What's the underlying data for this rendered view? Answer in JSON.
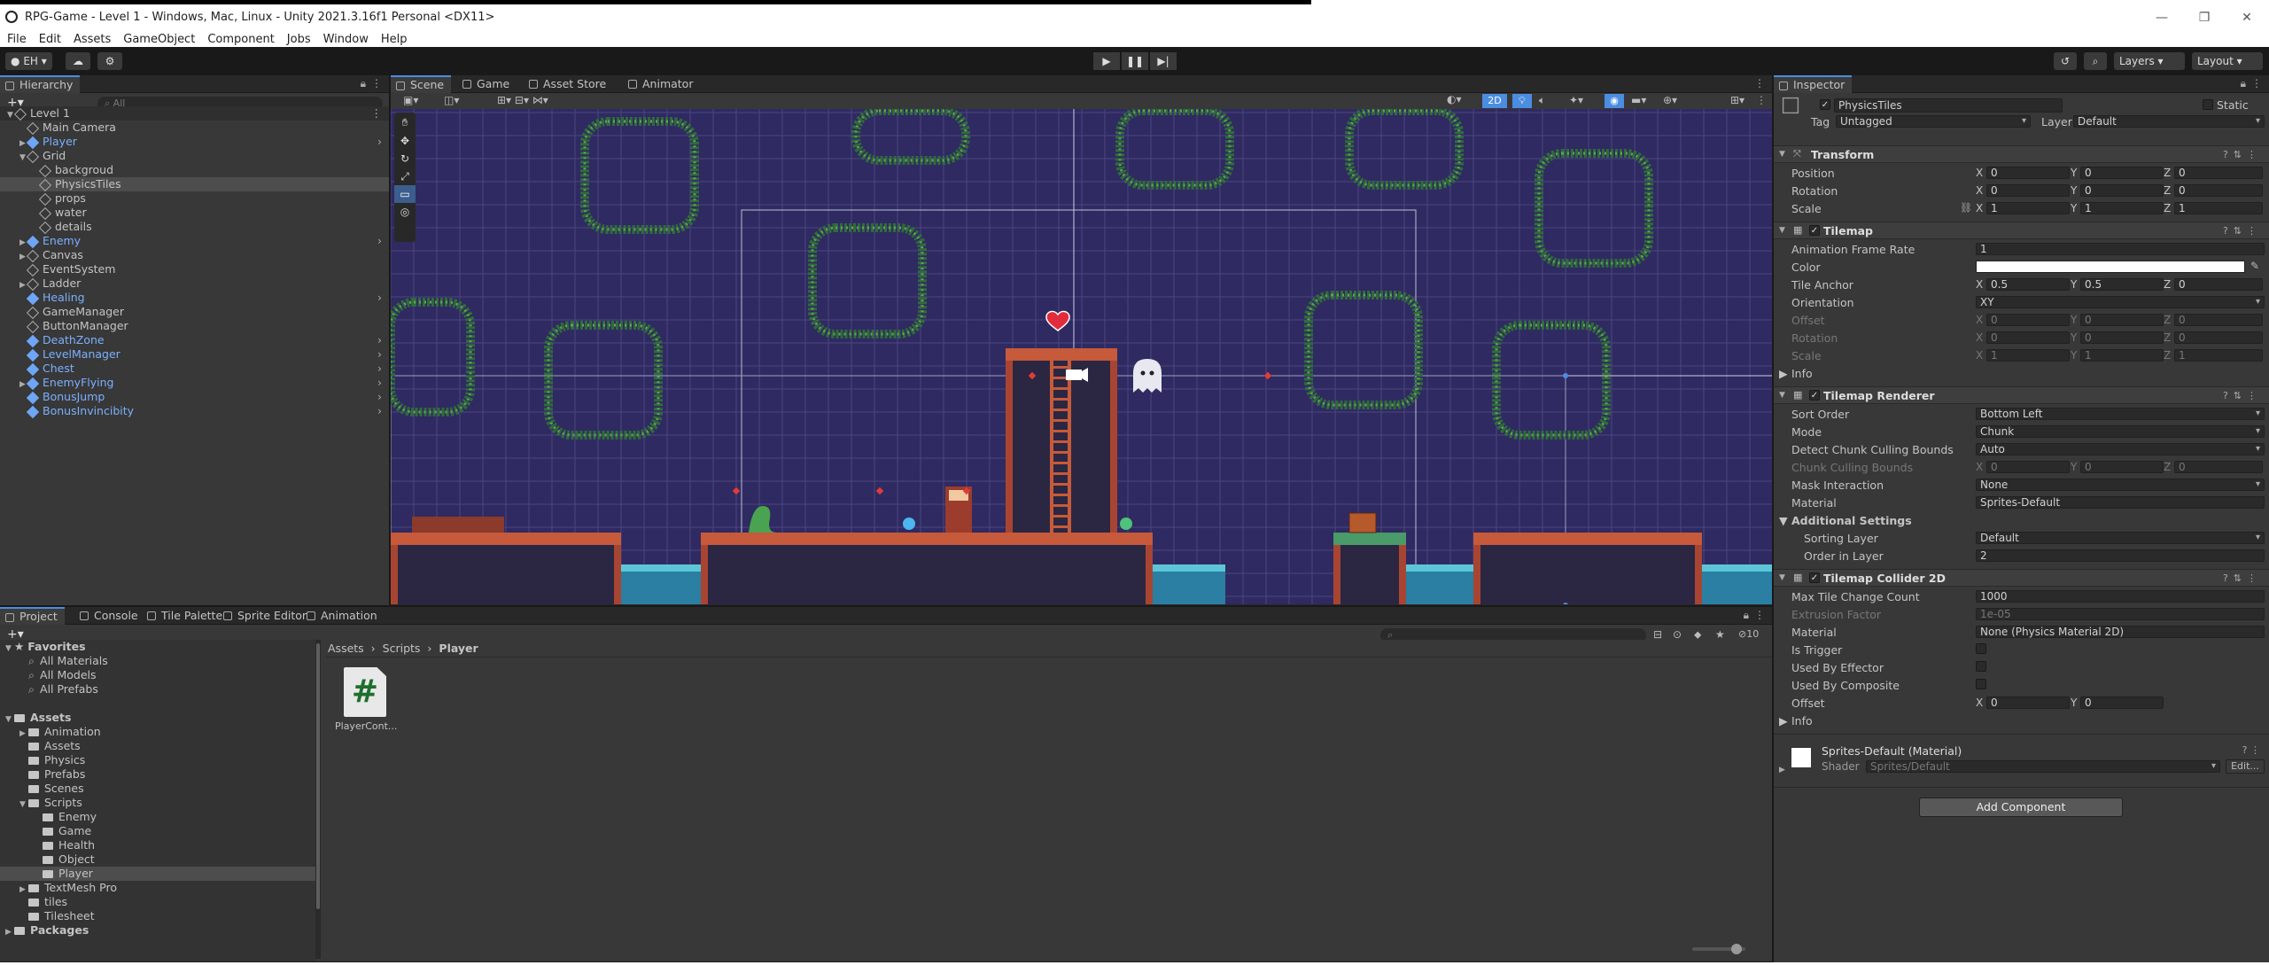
{
  "window": {
    "title": "RPG-Game - Level 1 - Windows, Mac, Linux - Unity 2021.3.16f1 Personal <DX11>",
    "minimize": "—",
    "maximize": "❐",
    "close": "✕"
  },
  "menu": [
    "File",
    "Edit",
    "Assets",
    "GameObject",
    "Component",
    "Jobs",
    "Window",
    "Help"
  ],
  "toolbar": {
    "account": "EH",
    "layers": "Layers",
    "layout": "Layout"
  },
  "hierarchy": {
    "tab": "Hierarchy",
    "search_placeholder": "All",
    "items": [
      {
        "label": "Level 1",
        "depth": 0,
        "expanded": true,
        "type": "scene"
      },
      {
        "label": "Main Camera",
        "depth": 1,
        "type": "object"
      },
      {
        "label": "Player",
        "depth": 1,
        "type": "prefab",
        "collapsed": true
      },
      {
        "label": "Grid",
        "depth": 1,
        "type": "object",
        "expanded": true
      },
      {
        "label": "backgroud",
        "depth": 2,
        "type": "object"
      },
      {
        "label": "PhysicsTiles",
        "depth": 2,
        "type": "object",
        "selected": true
      },
      {
        "label": "props",
        "depth": 2,
        "type": "object"
      },
      {
        "label": "water",
        "depth": 2,
        "type": "object"
      },
      {
        "label": "details",
        "depth": 2,
        "type": "object"
      },
      {
        "label": "Enemy",
        "depth": 1,
        "type": "prefab",
        "collapsed": true
      },
      {
        "label": "Canvas",
        "depth": 1,
        "type": "object",
        "collapsed": true
      },
      {
        "label": "EventSystem",
        "depth": 1,
        "type": "object"
      },
      {
        "label": "Ladder",
        "depth": 1,
        "type": "object",
        "collapsed": true
      },
      {
        "label": "Healing",
        "depth": 1,
        "type": "prefab"
      },
      {
        "label": "GameManager",
        "depth": 1,
        "type": "object"
      },
      {
        "label": "ButtonManager",
        "depth": 1,
        "type": "object"
      },
      {
        "label": "DeathZone",
        "depth": 1,
        "type": "prefab"
      },
      {
        "label": "LevelManager",
        "depth": 1,
        "type": "prefab"
      },
      {
        "label": "Chest",
        "depth": 1,
        "type": "prefab"
      },
      {
        "label": "EnemyFlying",
        "depth": 1,
        "type": "prefab",
        "collapsed": true
      },
      {
        "label": "BonusJump",
        "depth": 1,
        "type": "prefab"
      },
      {
        "label": "BonusInvincibity",
        "depth": 1,
        "type": "prefab"
      }
    ]
  },
  "scene_tabs": [
    {
      "label": "Scene",
      "active": true
    },
    {
      "label": "Game"
    },
    {
      "label": "Asset Store"
    },
    {
      "label": "Animator"
    }
  ],
  "scene_toolbar": {
    "mode_2d": "2D"
  },
  "inspector": {
    "tab": "Inspector",
    "object_name": "PhysicsTiles",
    "static_label": "Static",
    "tag_label": "Tag",
    "tag_value": "Untagged",
    "layer_label": "Layer",
    "layer_value": "Default",
    "transform": {
      "title": "Transform",
      "position_label": "Position",
      "position": [
        "0",
        "0",
        "0"
      ],
      "rotation_label": "Rotation",
      "rotation": [
        "0",
        "0",
        "0"
      ],
      "scale_label": "Scale",
      "scale": [
        "1",
        "1",
        "1"
      ]
    },
    "tilemap": {
      "title": "Tilemap",
      "anim_frame_rate_label": "Animation Frame Rate",
      "anim_frame_rate": "1",
      "color_label": "Color",
      "tile_anchor_label": "Tile Anchor",
      "tile_anchor": [
        "0.5",
        "0.5",
        "0"
      ],
      "orientation_label": "Orientation",
      "orientation": "XY",
      "offset_label": "Offset",
      "offset": [
        "0",
        "0",
        "0"
      ],
      "rotation_label": "Rotation",
      "rotation": [
        "0",
        "0",
        "0"
      ],
      "scale_label": "Scale",
      "scale": [
        "1",
        "1",
        "1"
      ],
      "info_label": "Info"
    },
    "tilemap_renderer": {
      "title": "Tilemap Renderer",
      "sort_order_label": "Sort Order",
      "sort_order": "Bottom Left",
      "mode_label": "Mode",
      "mode": "Chunk",
      "detect_label": "Detect Chunk Culling Bounds",
      "detect": "Auto",
      "chunk_bounds_label": "Chunk Culling Bounds",
      "chunk_bounds": [
        "0",
        "0",
        "0"
      ],
      "mask_label": "Mask Interaction",
      "mask": "None",
      "material_label": "Material",
      "material": "Sprites-Default",
      "additional_label": "Additional Settings",
      "sorting_layer_label": "Sorting Layer",
      "sorting_layer": "Default",
      "order_label": "Order in Layer",
      "order": "2"
    },
    "tilemap_collider": {
      "title": "Tilemap Collider 2D",
      "max_tile_label": "Max Tile Change Count",
      "max_tile": "1000",
      "extrusion_label": "Extrusion Factor",
      "extrusion": "1e-05",
      "material_label": "Material",
      "material": "None (Physics Material 2D)",
      "trigger_label": "Is Trigger",
      "effector_label": "Used By Effector",
      "composite_label": "Used By Composite",
      "offset_label": "Offset",
      "offset": [
        "0",
        "0"
      ],
      "info_label": "Info"
    },
    "material_block": {
      "name": "Sprites-Default (Material)",
      "shader_label": "Shader",
      "shader": "Sprites/Default",
      "edit": "Edit..."
    },
    "add_component": "Add Component",
    "axis": [
      "X",
      "Y",
      "Z"
    ]
  },
  "bottom_tabs": [
    {
      "label": "Project",
      "active": true
    },
    {
      "label": "Console"
    },
    {
      "label": "Tile Palette"
    },
    {
      "label": "Sprite Editor"
    },
    {
      "label": "Animation"
    }
  ],
  "project": {
    "favorites_label": "Favorites",
    "favorites": [
      "All Materials",
      "All Models",
      "All Prefabs"
    ],
    "assets_label": "Assets",
    "folders": [
      {
        "label": "Animation",
        "depth": 1,
        "collapsed": true
      },
      {
        "label": "Assets",
        "depth": 1
      },
      {
        "label": "Physics",
        "depth": 1
      },
      {
        "label": "Prefabs",
        "depth": 1
      },
      {
        "label": "Scenes",
        "depth": 1
      },
      {
        "label": "Scripts",
        "depth": 1,
        "expanded": true
      },
      {
        "label": "Enemy",
        "depth": 2
      },
      {
        "label": "Game",
        "depth": 2
      },
      {
        "label": "Health",
        "depth": 2
      },
      {
        "label": "Object",
        "depth": 2
      },
      {
        "label": "Player",
        "depth": 2,
        "selected": true
      },
      {
        "label": "TextMesh Pro",
        "depth": 1,
        "collapsed": true
      },
      {
        "label": "tiles",
        "depth": 1
      },
      {
        "label": "Tilesheet",
        "depth": 1
      }
    ],
    "packages_label": "Packages",
    "breadcrumb": [
      "Assets",
      "Scripts",
      "Player"
    ],
    "files": [
      {
        "label": "PlayerCont...",
        "icon": "#"
      }
    ],
    "hidden_count": "10"
  },
  "colors": {
    "accent": "#4b8de0",
    "prefab": "#7bb0ff",
    "scene_bg": "#2f2a61"
  }
}
